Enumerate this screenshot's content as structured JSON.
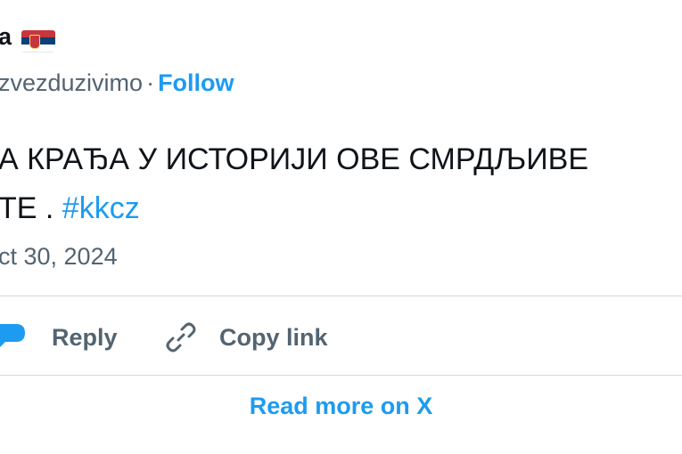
{
  "author": {
    "name": "a",
    "handle": "zvezduzivimo",
    "separator": "·",
    "follow_label": "Follow",
    "flag_icon": "serbia-flag-icon"
  },
  "tweet": {
    "line1": "А КРАЂА У ИСТОРИЈИ ОВЕ СМРДЉИВЕ",
    "line2_text": "ТЕ . ",
    "hashtag": "#kkcz",
    "date": "ct 30, 2024"
  },
  "actions": {
    "reply_label": "Reply",
    "copy_link_label": "Copy link",
    "read_more_label": "Read more on X"
  },
  "colors": {
    "accent": "#1d9bf0",
    "text_primary": "#0f1419",
    "text_secondary": "#536471",
    "divider": "#cfd9de",
    "flag_red": "#c6363c",
    "flag_blue": "#0c4076",
    "flag_white": "#ffffff"
  }
}
